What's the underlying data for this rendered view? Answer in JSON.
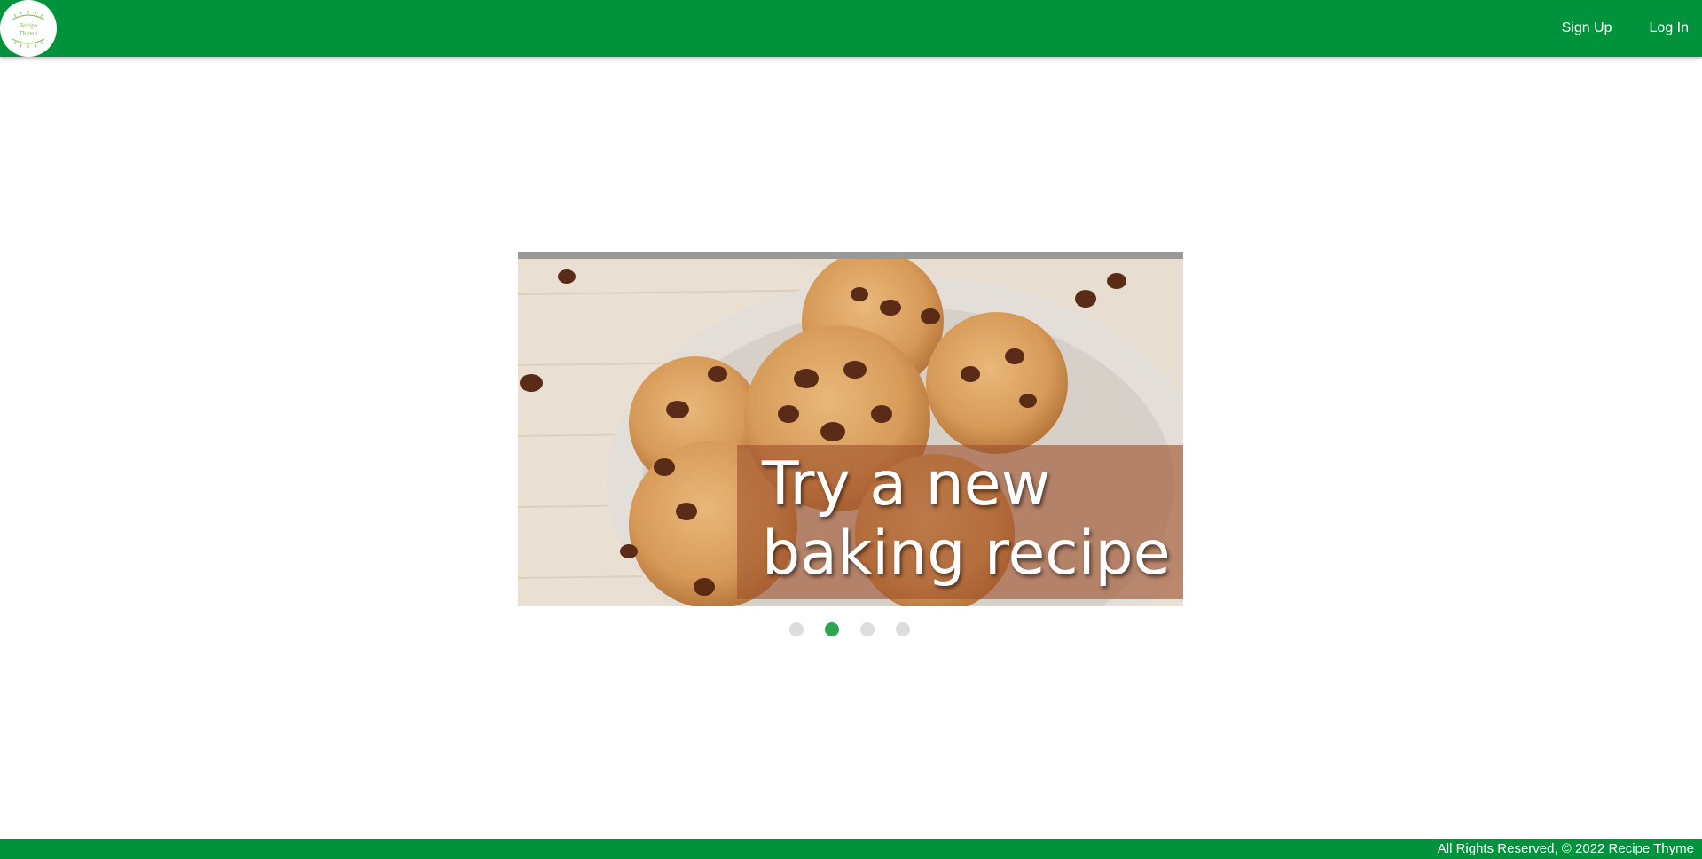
{
  "header": {
    "logo_text_top": "Recipe",
    "logo_text_bottom": "Thyme",
    "nav": [
      {
        "label": "Sign Up"
      },
      {
        "label": "Log In"
      }
    ]
  },
  "carousel": {
    "caption": "Try a new\nbaking recipe",
    "slide_count": 4,
    "active_index": 1
  },
  "footer": {
    "text": "All Rights Reserved, © 2022 Recipe Thyme"
  },
  "colors": {
    "brand_green": "#00933b",
    "active_dot": "#2ea44f",
    "inactive_dot": "#dddddd"
  }
}
